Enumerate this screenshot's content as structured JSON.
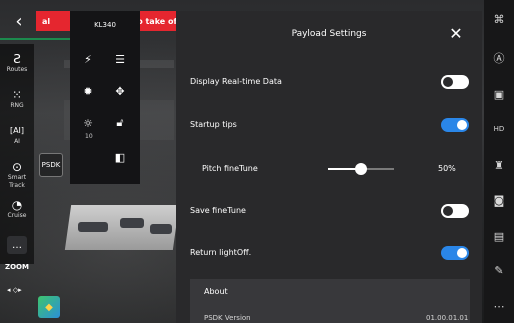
{
  "alert": {
    "left_text": "al",
    "right_text": "to take off"
  },
  "toolbar_left": {
    "items": [
      {
        "icon": "routes-icon",
        "glyph": "Ƨ",
        "label": "Routes"
      },
      {
        "icon": "rng-icon",
        "glyph": "⁙",
        "label": "RNG"
      },
      {
        "icon": "ai-icon",
        "glyph": "[AI]",
        "label": "AI"
      },
      {
        "icon": "smart-track-icon",
        "glyph": "⊙",
        "label": "Smart Track"
      },
      {
        "icon": "cruise-icon",
        "glyph": "◔",
        "label": "Cruise"
      }
    ],
    "more_glyph": "…",
    "zoom_label": "ZOOM",
    "zoom_arrows": "◂ ◇▸"
  },
  "payload_panel": {
    "title": "KL340",
    "sub_value": "10"
  },
  "settings": {
    "title": "Payload Settings",
    "rows": {
      "display_realtime": {
        "label": "Display Real-time Data",
        "on": false
      },
      "startup_tips": {
        "label": "Startup tips",
        "on": true
      },
      "pitch_finetune": {
        "label": "Pitch fineTune",
        "value": "50%",
        "percent": 50
      },
      "save_finetune": {
        "label": "Save fineTune",
        "on": false
      },
      "return_lightoff": {
        "label": "Return lightOff.",
        "on": true
      }
    },
    "about": {
      "title": "About",
      "psdk_key": "PSDK Version",
      "psdk_value": "01.00.01.01"
    }
  },
  "psdk_chip": "PSDK",
  "toolbar_right": [
    {
      "icon": "command-icon",
      "glyph": "⌘"
    },
    {
      "icon": "auto-mode-icon",
      "glyph": "Ⓐ"
    },
    {
      "icon": "robot-icon",
      "glyph": "▣"
    },
    {
      "icon": "hd-icon",
      "glyph": "HD"
    },
    {
      "icon": "gimbal-icon",
      "glyph": "♜"
    },
    {
      "icon": "camera-icon",
      "glyph": "◙"
    },
    {
      "icon": "psdk-icon",
      "glyph": "▤"
    },
    {
      "icon": "wrench-icon",
      "glyph": "✎"
    },
    {
      "icon": "more-icon",
      "glyph": "⋯"
    }
  ]
}
